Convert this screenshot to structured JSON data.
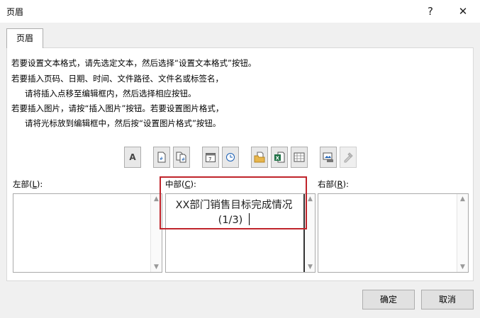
{
  "window": {
    "title": "页眉",
    "help_glyph": "?",
    "close_glyph": "✕"
  },
  "tab": {
    "label": "页眉"
  },
  "instructions": [
    "若要设置文本格式，请先选定文本，然后选择“设置文本格式”按钮。",
    "若要插入页码、日期、时间、文件路径、文件名或标签名，",
    "请将插入点移至编辑框内，然后选择相应按钮。",
    "若要插入图片，请按“插入图片”按钮。若要设置图片格式，",
    "请将光标放到编辑框中，然后按“设置图片格式”按钮。"
  ],
  "toolbar": {
    "format_text_glyph": "A",
    "icons": [
      "format-text-icon",
      "page-number-icon",
      "page-count-icon",
      "date-icon",
      "time-icon",
      "file-path-icon",
      "file-name-icon",
      "sheet-name-icon",
      "insert-picture-icon",
      "format-picture-icon"
    ]
  },
  "sections": {
    "left": {
      "label_pre": "左部(",
      "key": "L",
      "label_post": "):"
    },
    "center": {
      "label_pre": "中部(",
      "key": "C",
      "label_post": "):",
      "line1": "XX部门销售目标完成情况",
      "line2": "(1/3)"
    },
    "right": {
      "label_pre": "右部(",
      "key": "R",
      "label_post": "):"
    }
  },
  "scroll": {
    "up": "▲",
    "down": "▼"
  },
  "buttons": {
    "ok": "确定",
    "cancel": "取消"
  },
  "colors": {
    "highlight": "#c0242b"
  }
}
